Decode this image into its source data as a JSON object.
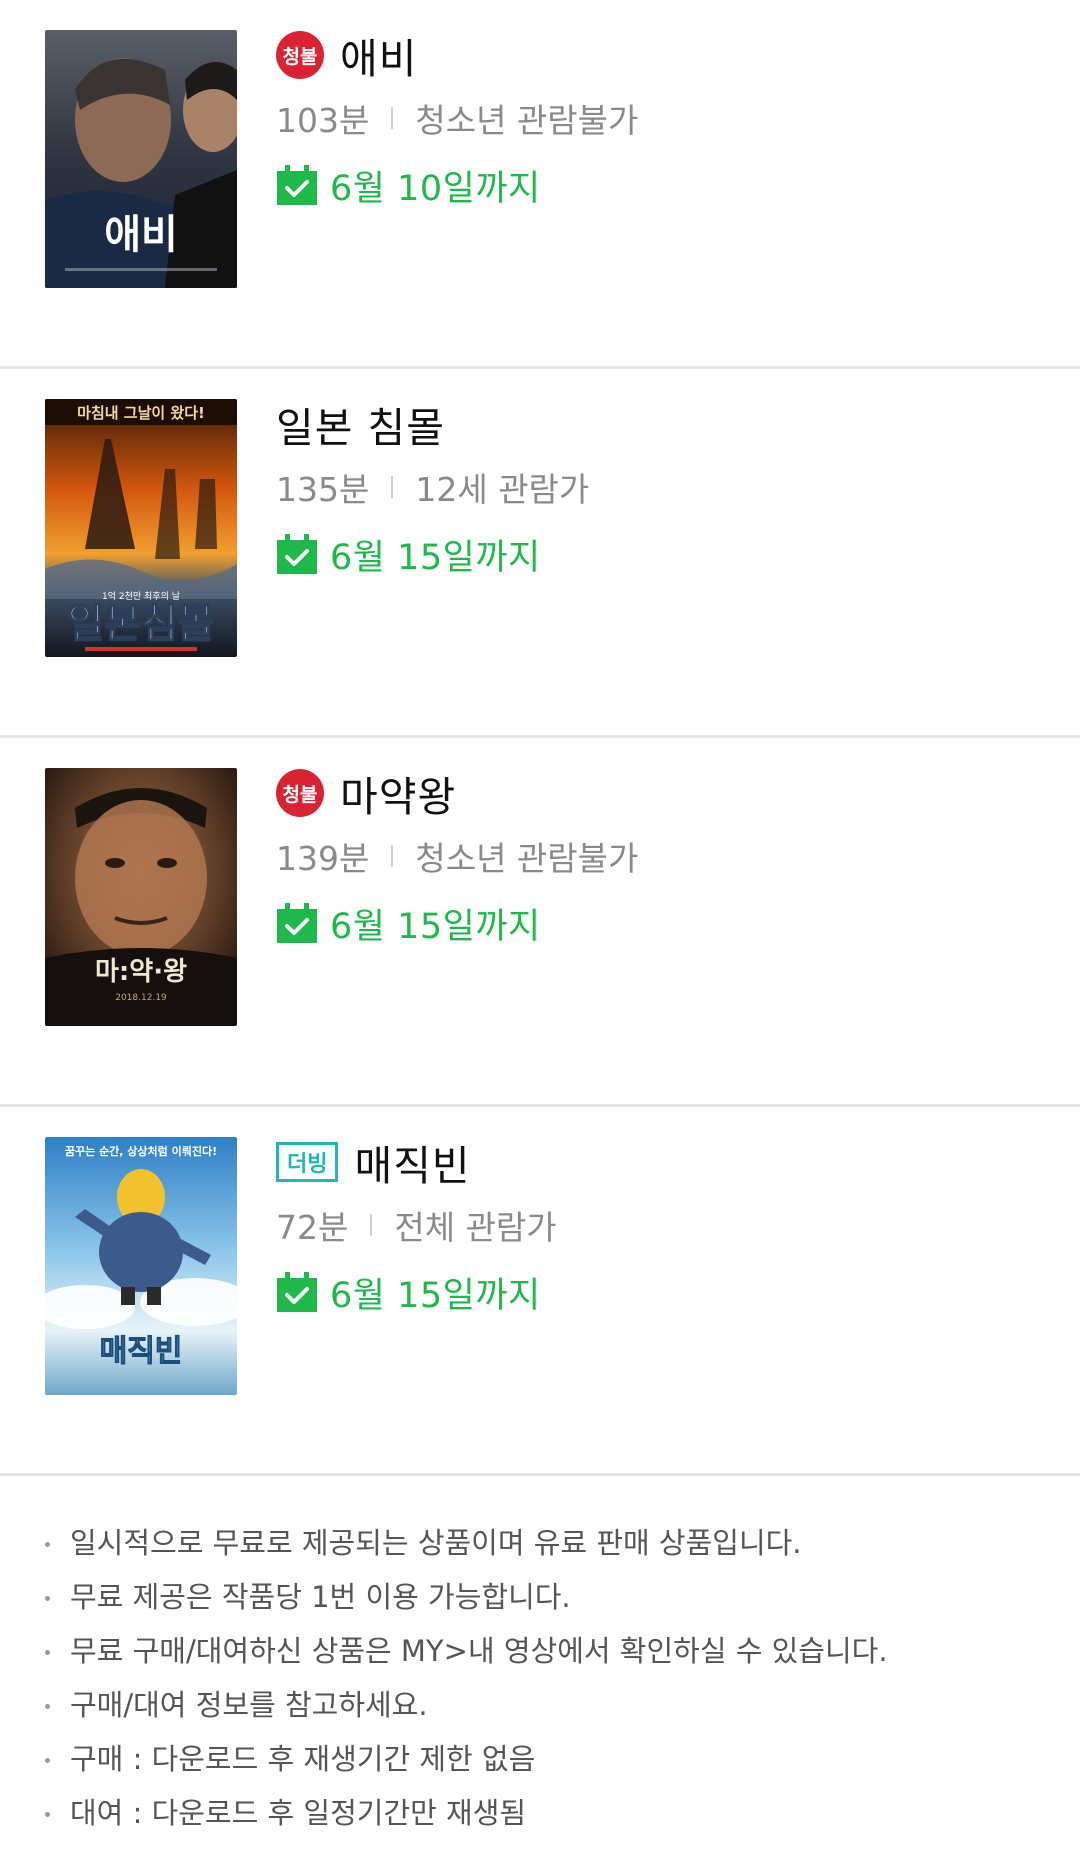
{
  "movies": [
    {
      "title": "애비",
      "badge": "청불",
      "badge_type": "adult",
      "runtime": "103분",
      "rating": "청소년 관람불가",
      "until": "6월 10일까지",
      "poster_text": "애비",
      "poster_icon": "poster-image"
    },
    {
      "title": "일본 침몰",
      "badge": "",
      "badge_type": "none",
      "runtime": "135분",
      "rating": "12세 관람가",
      "until": "6월 15일까지",
      "poster_top_text": "마침내 그날이 왔다!",
      "poster_text": "일본침몰",
      "poster_icon": "poster-image"
    },
    {
      "title": "마약왕",
      "badge": "청불",
      "badge_type": "adult",
      "runtime": "139분",
      "rating": "청소년 관람불가",
      "until": "6월 15일까지",
      "poster_text": "마:약·왕",
      "poster_icon": "poster-image"
    },
    {
      "title": "매직빈",
      "badge": "더빙",
      "badge_type": "dub",
      "runtime": "72분",
      "rating": "전체 관람가",
      "until": "6월 15일까지",
      "poster_top_text": "꿈꾸는 순간, 상상처럼 이뤄진다!",
      "poster_text": "매직빈",
      "poster_icon": "poster-image"
    }
  ],
  "notices": [
    "일시적으로 무료로 제공되는 상품이며 유료 판매 상품입니다.",
    "무료 제공은 작품당 1번 이용 가능합니다.",
    "무료 구매/대여하신 상품은 MY>내 영상에서 확인하실 수 있습니다.",
    "구매/대여 정보를 참고하세요.",
    "구매 : 다운로드 후 재생기간 제한 없음",
    "대여 : 다운로드 후 일정기간만 재생됨"
  ],
  "colors": {
    "accent_green": "#1fb84b",
    "adult_red": "#d92332",
    "dub_teal": "#1fb8b2",
    "meta_gray": "#8a8a8a"
  }
}
